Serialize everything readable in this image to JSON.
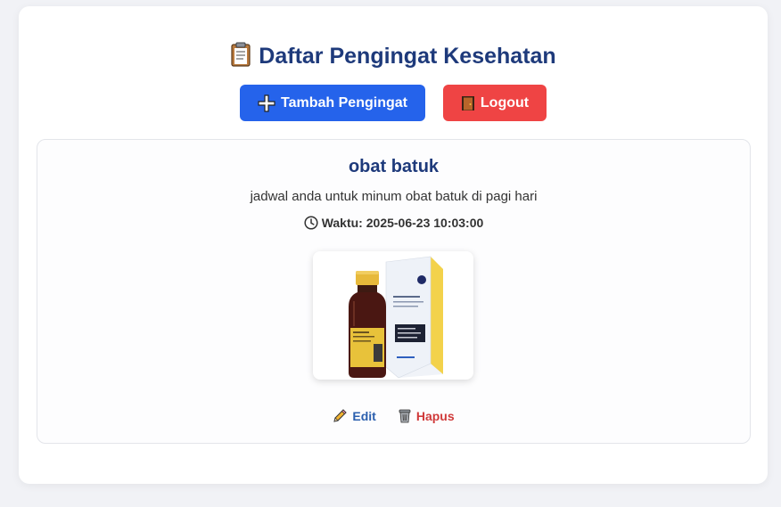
{
  "header": {
    "title": "Daftar Pengingat Kesehatan",
    "title_icon": "clipboard-icon"
  },
  "actions": {
    "add_label": "Tambah Pengingat",
    "add_icon": "plus-icon",
    "logout_label": "Logout",
    "logout_icon": "door-icon"
  },
  "reminders": [
    {
      "title": "obat batuk",
      "description": "jadwal anda untuk minum obat batuk di pagi hari",
      "time_label": "Waktu:",
      "time_value": "2025-06-23 10:03:00",
      "image_alt": "cough syrup bottle and box",
      "edit_label": "Edit",
      "delete_label": "Hapus"
    }
  ],
  "colors": {
    "primary": "#2563eb",
    "danger": "#ef4444",
    "title": "#1e3a7b"
  }
}
